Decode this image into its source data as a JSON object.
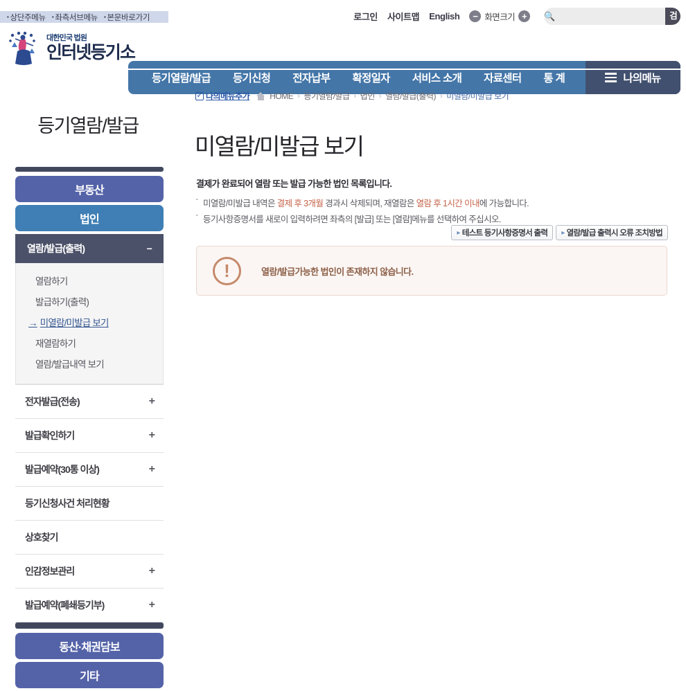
{
  "skiplinks": [
    "상단주메뉴",
    "좌측서브메뉴",
    "본문바로가기"
  ],
  "utility": {
    "login": "로그인",
    "sitemap": "사이트맵",
    "english": "English",
    "zoom_label": "화면크기",
    "zoom_out": "−",
    "zoom_in": "+",
    "search_placeholder": "",
    "search_value": "",
    "search_button": "검색"
  },
  "logo": {
    "small": "대한민국 법원",
    "big": "인터넷등기소"
  },
  "gnb": {
    "items": [
      "등기열람/발급",
      "등기신청",
      "전자납부",
      "확정일자",
      "서비스 소개",
      "자료센터",
      "통 계"
    ],
    "mymenu": "나의메뉴"
  },
  "breadcrumb": {
    "add_label": "나의메뉴추가",
    "home": "HOME",
    "path": [
      "등기열람/발급",
      "법인",
      "열람/발급(출력)",
      "미열람/미발급 보기"
    ]
  },
  "page": {
    "title": "미열람/미발급 보기"
  },
  "description": {
    "lead": "결제가 완료되어 열람 또는 발급 가능한 법인 목록입니다.",
    "items": [
      {
        "pre": "미열람/미발급 내역은 ",
        "hl1": "결제 후 3개월",
        "mid": " 경과시 삭제되며, 재열람은 ",
        "hl2": "열람 후 1시간 이내",
        "post": "에 가능합니다."
      },
      {
        "full": "등기사항증명서를 새로이 입력하려면 좌측의 [발급] 또는 [열람]메뉴를 선택하여 주십시오."
      }
    ]
  },
  "buttons": [
    {
      "label": "테스트 등기사항증명서 출력"
    },
    {
      "label": "열람/발급 출력시 오류 조치방법"
    }
  ],
  "alert": {
    "message": "열람/발급가능한 법인이 존재하지 않습니다."
  },
  "sidebar": {
    "title": "등기열람/발급",
    "categories": [
      {
        "label": "부동산",
        "style": "estate"
      },
      {
        "label": "법인",
        "style": "corp"
      }
    ],
    "expanded": {
      "header": "열람/발급(출력)",
      "toggle": "−",
      "items": [
        {
          "label": "열람하기",
          "active": false
        },
        {
          "label": "발급하기(출력)",
          "active": false
        },
        {
          "label": "미열람/미발급 보기",
          "active": true
        },
        {
          "label": "재열람하기",
          "active": false
        },
        {
          "label": "열람/발급내역 보기",
          "active": false
        }
      ]
    },
    "accordions": [
      {
        "label": "전자발급(전송)",
        "toggle": "+"
      },
      {
        "label": "발급확인하기",
        "toggle": "+"
      },
      {
        "label": "발급예약(30통 이상)",
        "toggle": "+"
      },
      {
        "label": "등기신청사건 처리현황",
        "toggle": ""
      },
      {
        "label": "상호찾기",
        "toggle": ""
      },
      {
        "label": "인감정보관리",
        "toggle": "+"
      },
      {
        "label": "발급예약(폐쇄등기부)",
        "toggle": "+"
      }
    ],
    "bottom_categories": [
      {
        "label": "동산·채권담보",
        "style": "other"
      },
      {
        "label": "기타",
        "style": "other"
      }
    ]
  },
  "colors": {
    "gnb_blue": "#4476a8",
    "mymenu_dark": "#41506e",
    "estate_purple": "#5463a8",
    "corp_blue": "#3f7fb5",
    "submenu_dark": "#4b5168",
    "alert_bg": "#fbf6f3",
    "alert_accent": "#c58a6b",
    "highlight_red": "#c5634a"
  }
}
